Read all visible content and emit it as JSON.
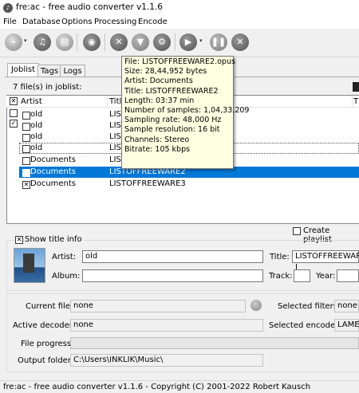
{
  "window": {
    "title": "fre:ac - free audio converter v1.1.6",
    "icon": "app-logo-icon"
  },
  "menu": [
    "File",
    "Database",
    "Options",
    "Processing",
    "Encode"
  ],
  "toolbar": {
    "buttons": [
      "add-files-icon",
      "add-cd-icon",
      "add-folder-icon",
      "cddb-query-icon",
      "remove-icon",
      "filter-icon",
      "settings-icon",
      "start-encoding-icon",
      "pause-icon",
      "stop-icon"
    ],
    "dropdown_glyph": "▾"
  },
  "tabs": [
    "Joblist",
    "Tags",
    "Logs"
  ],
  "joblist": {
    "count_text": "7 file(s) in joblist:",
    "columns": [
      "Artist",
      "Title",
      "T"
    ],
    "rows": [
      {
        "artist": "old",
        "title": "LIST",
        "checked": false,
        "state": "normal"
      },
      {
        "artist": "old",
        "title": "LIST",
        "checked": false,
        "state": "normal"
      },
      {
        "artist": "old",
        "title": "LIST",
        "checked": false,
        "state": "normal"
      },
      {
        "artist": "old",
        "title": "LIST",
        "checked": false,
        "state": "dotted"
      },
      {
        "artist": "Documents",
        "title": "LIST",
        "checked": false,
        "state": "normal"
      },
      {
        "artist": "Documents",
        "title": "LISTOFFREEWARE2",
        "checked": false,
        "state": "selected"
      },
      {
        "artist": "Documents",
        "title": "LISTOFFREEWARE3",
        "checked": true,
        "state": "normal"
      }
    ]
  },
  "tooltip": [
    "File: LISTOFFREEWARE2.opus",
    "Size: 28,44,952 bytes",
    "Artist: Documents",
    "Title: LISTOFFREEWARE2",
    "Length: 03:37 min",
    "Number of samples: 1,04,33,209",
    "Sampling rate: 48,000 Hz",
    "Sample resolution: 16 bit",
    "Channels: Stereo",
    "Bitrate: 105 kbps"
  ],
  "playlist": {
    "label": "Create playlist",
    "checked": false
  },
  "title_info": {
    "toggle_label": "Show title info",
    "toggle_checked": true,
    "artist_label": "Artist:",
    "artist_value": "old",
    "title_label": "Title:",
    "title_value": "LISTOFFREEWARE I",
    "album_label": "Album:",
    "album_value": "",
    "track_label": "Track:",
    "track_value": "",
    "year_label": "Year:",
    "year_value": ""
  },
  "status": {
    "current_file_label": "Current file:",
    "current_file_value": "none",
    "active_decoder_label": "Active decoder:",
    "active_decoder_value": "none",
    "selected_filters_label": "Selected filters:",
    "selected_filters_value": "none",
    "selected_encoder_label": "Selected encoder:",
    "selected_encoder_value": "LAME",
    "file_progress_label": "File progress:",
    "file_progress": 0,
    "output_folder_label": "Output folder:",
    "output_folder_value": "C:\\Users\\INKLIK\\Music\\"
  },
  "statusbar": {
    "text": "fre:ac - free audio converter v1.1.6 - Copyright (C) 2001-2022 Robert Kausch"
  },
  "colors": {
    "selection": "#0078d7",
    "tooltip_bg": "#ffffe1",
    "window_bg": "#f0f0f0"
  }
}
